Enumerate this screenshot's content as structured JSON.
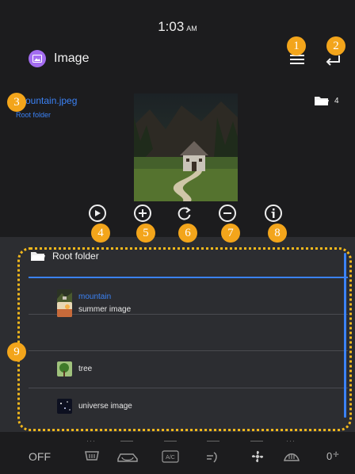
{
  "status": {
    "time": "1:03",
    "ampm": "AM"
  },
  "app": {
    "title": "Image",
    "icon": "image-icon"
  },
  "header_icons": {
    "menu": "menu-icon",
    "back": "back-icon"
  },
  "file": {
    "name": "mountain.jpeg",
    "folder": "Root folder"
  },
  "folder_count": {
    "icon": "folder-icon",
    "count": "4"
  },
  "tools": [
    {
      "icon": "play-icon"
    },
    {
      "icon": "zoom-in-icon"
    },
    {
      "icon": "rotate-icon"
    },
    {
      "icon": "zoom-out-icon"
    },
    {
      "icon": "info-icon"
    }
  ],
  "badges": [
    "1",
    "2",
    "3",
    "4",
    "5",
    "6",
    "7",
    "8",
    "9"
  ],
  "list": {
    "root_label": "Root folder",
    "items": [
      {
        "label": "mountain",
        "active": true
      },
      {
        "label": "summer image",
        "active": false
      },
      {
        "label": "tree",
        "active": false
      },
      {
        "label": "universe image",
        "active": false
      }
    ]
  },
  "climate": {
    "off_label": "OFF",
    "fan_level": "0",
    "icons": [
      "rear-defrost-icon",
      "recirculation-icon",
      "ac-icon",
      "airflow-icon",
      "fan-icon",
      "front-defrost-icon"
    ]
  },
  "colors": {
    "accent": "#3b82f6",
    "badge": "#f3a51b",
    "app_icon": "#a36cf0"
  }
}
